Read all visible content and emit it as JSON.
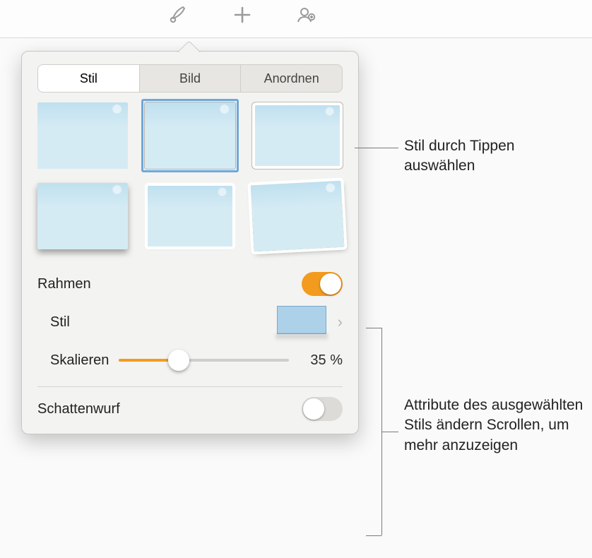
{
  "toolbar": {
    "icons": [
      "format-brush-icon",
      "add-icon",
      "collaborate-icon"
    ]
  },
  "tabs": {
    "style": "Stil",
    "image": "Bild",
    "arrange": "Anordnen",
    "active": 0
  },
  "style_grid": {
    "items": [
      {
        "variant": "plain"
      },
      {
        "variant": "selected frame-thin",
        "selected": true
      },
      {
        "variant": "frame-outer frame-thick"
      },
      {
        "variant": "shadow"
      },
      {
        "variant": "white-border"
      },
      {
        "variant": "tilt"
      }
    ]
  },
  "frame": {
    "heading": "Rahmen",
    "enabled": true,
    "style_label": "Stil",
    "scale_label": "Skalieren",
    "scale_value_text": "35 %",
    "scale_percent": 35
  },
  "shadow": {
    "heading": "Schattenwurf",
    "enabled": false
  },
  "callouts": {
    "c1": "Stil durch Tippen auswählen",
    "c2": "Attribute des ausgewählten Stils ändern Scrollen, um mehr anzuzeigen"
  },
  "colors": {
    "accent": "#f39b1e"
  }
}
